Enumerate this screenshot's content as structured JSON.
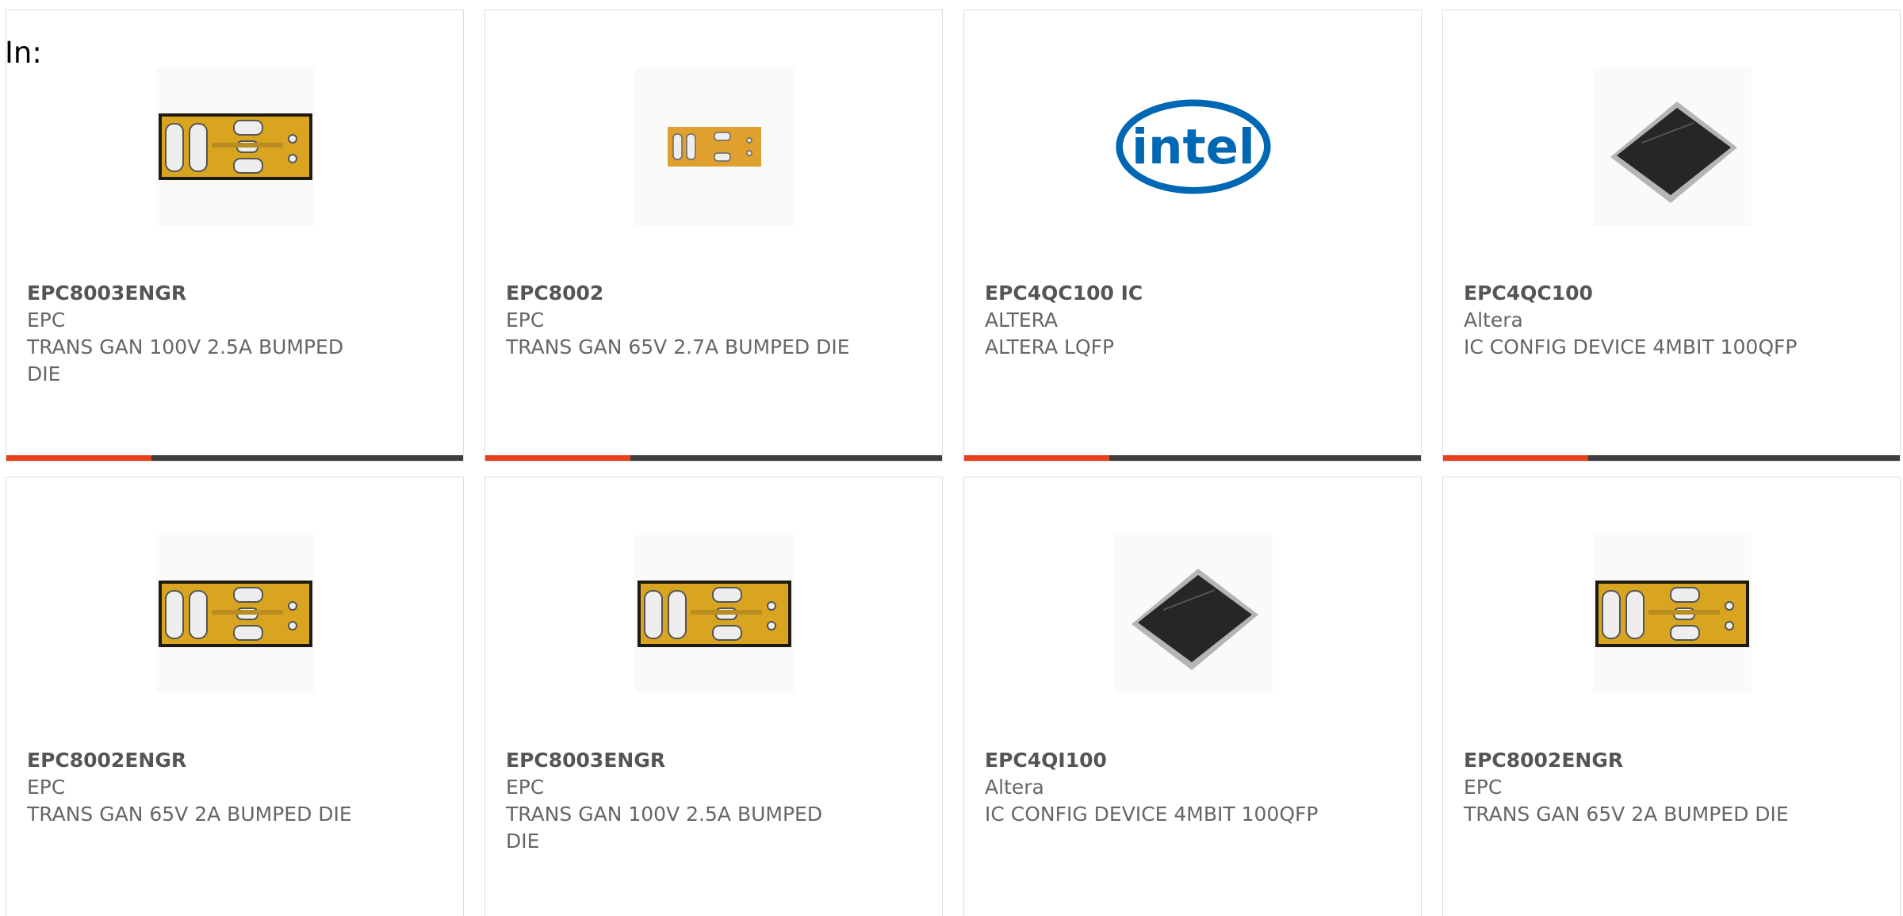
{
  "prefix_label": "In:",
  "colors": {
    "accent_bar": "#e8401c",
    "dark_bar": "#3d3d3d",
    "border": "#dcdcdc",
    "text": "#666666"
  },
  "cards": [
    {
      "part": "EPC8003ENGR",
      "manufacturer": "EPC",
      "description": "TRANS GAN 100V 2.5A BUMPED DIE",
      "image": "gan-die-board"
    },
    {
      "part": "EPC8002",
      "manufacturer": "EPC",
      "description": "TRANS GAN 65V 2.7A BUMPED DIE",
      "image": "gan-die-board-small"
    },
    {
      "part": "EPC4QC100 IC",
      "manufacturer": "ALTERA",
      "description": "ALTERA LQFP",
      "image": "intel-logo"
    },
    {
      "part": "EPC4QC100",
      "manufacturer": "Altera",
      "description": "IC CONFIG DEVICE 4MBIT 100QFP",
      "image": "qfp-chip"
    },
    {
      "part": "EPC8002ENGR",
      "manufacturer": "EPC",
      "description": "TRANS GAN 65V 2A BUMPED DIE",
      "image": "gan-die-board"
    },
    {
      "part": "EPC8003ENGR",
      "manufacturer": "EPC",
      "description": "TRANS GAN 100V 2.5A BUMPED DIE",
      "image": "gan-die-board"
    },
    {
      "part": "EPC4QI100",
      "manufacturer": "Altera",
      "description": "IC CONFIG DEVICE 4MBIT 100QFP",
      "image": "qfp-chip"
    },
    {
      "part": "EPC8002ENGR",
      "manufacturer": "EPC",
      "description": "TRANS GAN 65V 2A BUMPED DIE",
      "image": "gan-die-board"
    }
  ],
  "logo_text": "intel"
}
